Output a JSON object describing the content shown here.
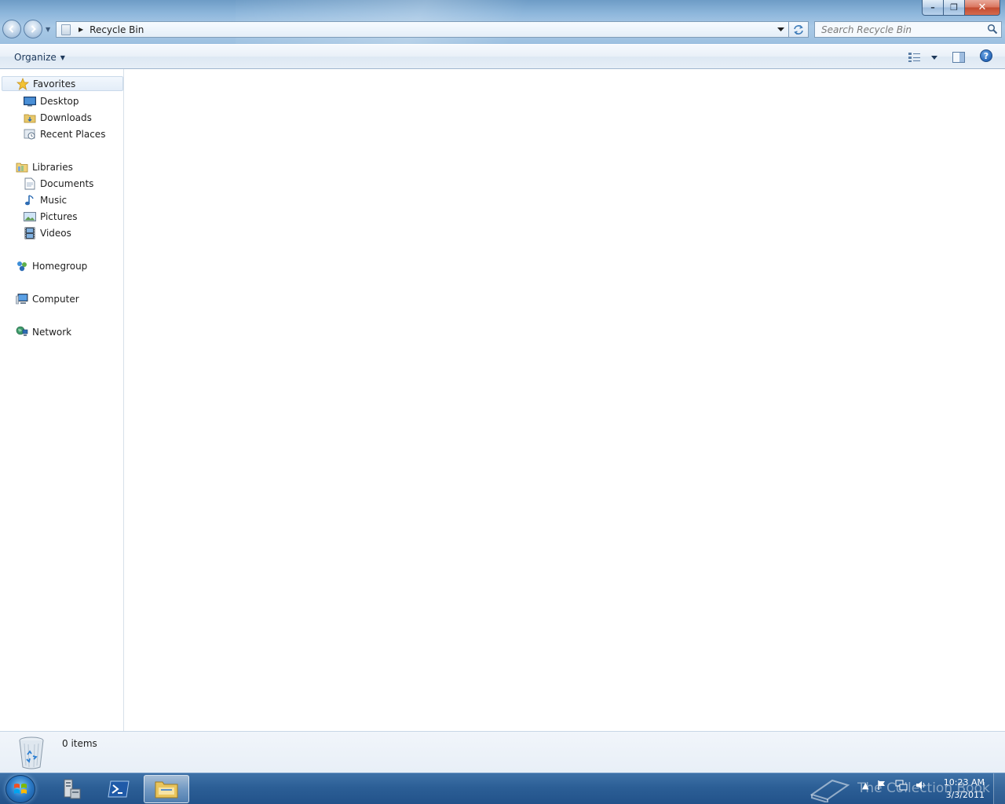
{
  "window": {
    "caption": {
      "minimize": "–",
      "maximize": "❐",
      "close": "✕"
    }
  },
  "address": {
    "crumb": "Recycle Bin"
  },
  "search": {
    "placeholder": "Search Recycle Bin"
  },
  "toolbar": {
    "organize_label": "Organize"
  },
  "nav": {
    "favorites": {
      "label": "Favorites",
      "items": [
        {
          "label": "Desktop"
        },
        {
          "label": "Downloads"
        },
        {
          "label": "Recent Places"
        }
      ]
    },
    "libraries": {
      "label": "Libraries",
      "items": [
        {
          "label": "Documents"
        },
        {
          "label": "Music"
        },
        {
          "label": "Pictures"
        },
        {
          "label": "Videos"
        }
      ]
    },
    "homegroup": {
      "label": "Homegroup"
    },
    "computer": {
      "label": "Computer"
    },
    "network": {
      "label": "Network"
    }
  },
  "details": {
    "item_count": "0 items"
  },
  "taskbar": {
    "clock_time": "10:23 AM",
    "clock_date": "3/3/2011",
    "watermark": "The Collection Book"
  },
  "colors": {
    "taskbar": "#2c5f96",
    "selection": "#e3edf8",
    "link_text": "#1e395b"
  }
}
